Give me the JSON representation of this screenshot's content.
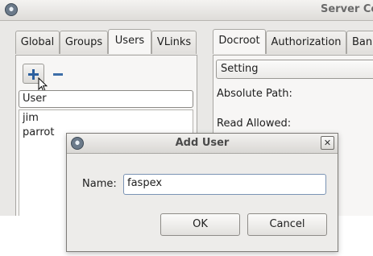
{
  "main_window": {
    "title": "Server Co",
    "left_tabs": [
      "Global",
      "Groups",
      "Users",
      "VLinks"
    ],
    "left_active_tab": "Users",
    "toolbar": {
      "add_icon": "plus-icon",
      "remove_icon": "minus-icon"
    },
    "users_filter_value": "User",
    "users_list": [
      "jim",
      "parrot"
    ],
    "right_tabs": [
      "Docroot",
      "Authorization",
      "Ban"
    ],
    "right_active_tab": "Docroot",
    "setting_select_value": "Setting",
    "labels": {
      "absolute_path": "Absolute Path:",
      "read_allowed": "Read Allowed:"
    }
  },
  "dialog": {
    "title": "Add User",
    "name_label": "Name:",
    "name_value": "faspex",
    "ok_label": "OK",
    "cancel_label": "Cancel",
    "close_glyph": "✕"
  },
  "colors": {
    "accent_blue": "#2b5f9e",
    "window_bg": "#e9e8e6",
    "dialog_bg": "#edecea"
  }
}
